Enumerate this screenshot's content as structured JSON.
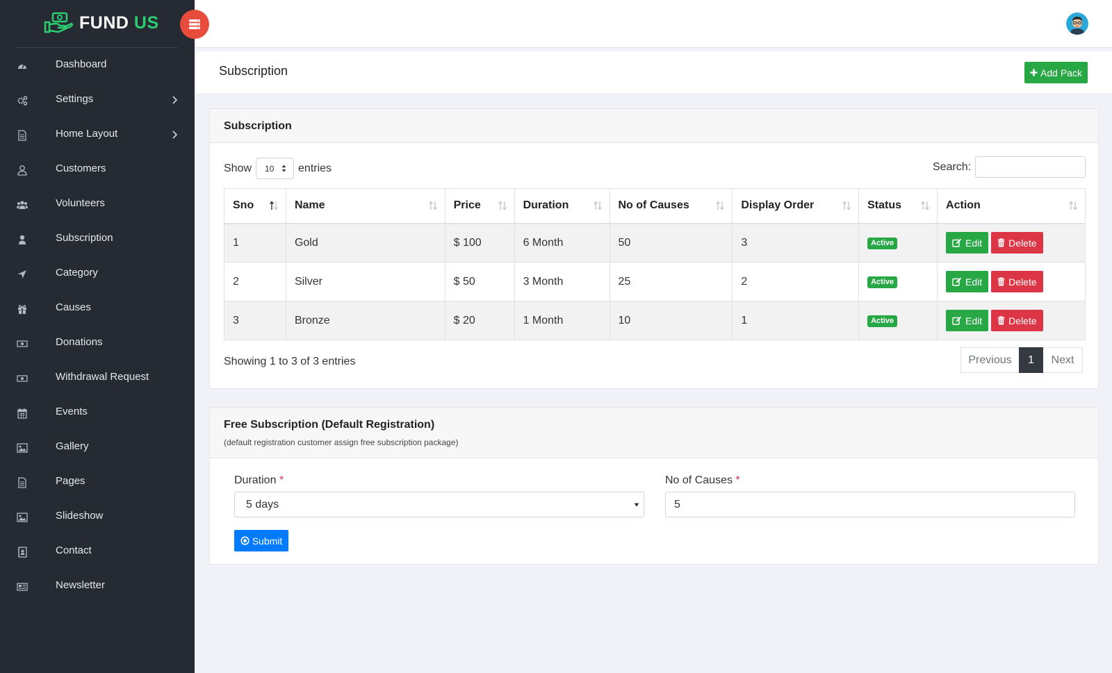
{
  "brand": {
    "name_part1": "FUND",
    "name_part2": "US",
    "accent_color": "#2ecc71"
  },
  "sidebar": {
    "items": [
      {
        "label": "Dashboard",
        "icon": "dashboard-icon",
        "has_submenu": false
      },
      {
        "label": "Settings",
        "icon": "cogs-icon",
        "has_submenu": true
      },
      {
        "label": "Home Layout",
        "icon": "file-icon",
        "has_submenu": true
      },
      {
        "label": "Customers",
        "icon": "user-outline-icon",
        "has_submenu": false
      },
      {
        "label": "Volunteers",
        "icon": "users-icon",
        "has_submenu": false
      },
      {
        "label": "Subscription",
        "icon": "user-icon",
        "has_submenu": false
      },
      {
        "label": "Category",
        "icon": "location-arrow-icon",
        "has_submenu": false
      },
      {
        "label": "Causes",
        "icon": "gift-icon",
        "has_submenu": false
      },
      {
        "label": "Donations",
        "icon": "money-icon",
        "has_submenu": false
      },
      {
        "label": "Withdrawal Request",
        "icon": "money-icon",
        "has_submenu": false
      },
      {
        "label": "Events",
        "icon": "calendar-icon",
        "has_submenu": false
      },
      {
        "label": "Gallery",
        "icon": "image-icon",
        "has_submenu": false
      },
      {
        "label": "Pages",
        "icon": "file-icon",
        "has_submenu": false
      },
      {
        "label": "Slideshow",
        "icon": "image-icon",
        "has_submenu": false
      },
      {
        "label": "Contact",
        "icon": "address-book-icon",
        "has_submenu": false
      },
      {
        "label": "Newsletter",
        "icon": "newspaper-icon",
        "has_submenu": false
      }
    ]
  },
  "header": {
    "page_title": "Subscription",
    "add_button": "Add Pack"
  },
  "subscription_card": {
    "title": "Subscription",
    "show_label": "Show",
    "entries_label": "entries",
    "page_length": "10",
    "search_label": "Search:",
    "search_value": "",
    "columns": [
      "Sno",
      "Name",
      "Price",
      "Duration",
      "No of Causes",
      "Display Order",
      "Status",
      "Action"
    ],
    "rows": [
      {
        "sno": "1",
        "name": "Gold",
        "price": "$ 100",
        "duration": "6 Month",
        "causes": "50",
        "order": "3",
        "status": "Active"
      },
      {
        "sno": "2",
        "name": "Silver",
        "price": "$ 50",
        "duration": "3 Month",
        "causes": "25",
        "order": "2",
        "status": "Active"
      },
      {
        "sno": "3",
        "name": "Bronze",
        "price": "$ 20",
        "duration": "1 Month",
        "causes": "10",
        "order": "1",
        "status": "Active"
      }
    ],
    "edit_label": "Edit",
    "delete_label": "Delete",
    "info": "Showing 1 to 3 of 3 entries",
    "pagination": {
      "previous": "Previous",
      "current": "1",
      "next": "Next"
    }
  },
  "free_card": {
    "title": "Free Subscription (Default Registration)",
    "subtitle": "(default registration customer assign free subscription package)",
    "duration_label": "Duration",
    "required_mark": "*",
    "duration_value": "5 days",
    "causes_label": "No of Causes",
    "causes_value": "5",
    "submit": "Submit"
  }
}
